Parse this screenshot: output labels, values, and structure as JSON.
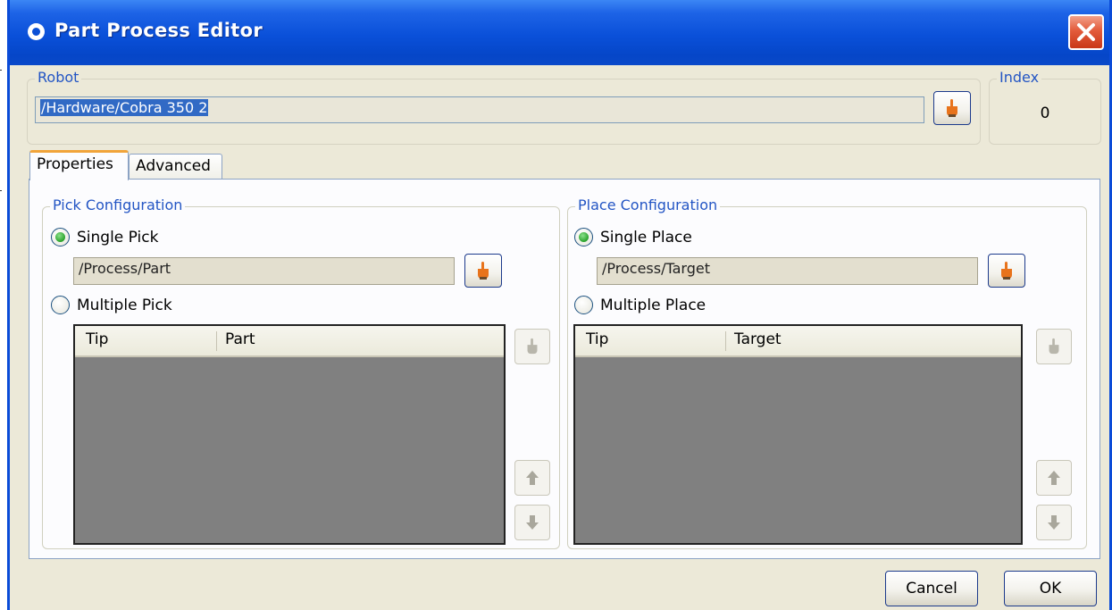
{
  "window": {
    "title": "Part Process Editor"
  },
  "robot": {
    "label": "Robot",
    "value": "/Hardware/Cobra 350 2"
  },
  "index": {
    "label": "Index",
    "value": "0"
  },
  "tabs": [
    {
      "label": "Properties",
      "active": true
    },
    {
      "label": "Advanced",
      "active": false
    }
  ],
  "pick": {
    "group_label": "Pick Configuration",
    "single_label": "Single Pick",
    "single_checked": true,
    "single_value": "/Process/Part",
    "multiple_label": "Multiple Pick",
    "columns": [
      "Tip",
      "Part"
    ]
  },
  "place": {
    "group_label": "Place Configuration",
    "single_label": "Single Place",
    "single_checked": true,
    "single_value": "/Process/Target",
    "multiple_label": "Multiple Place",
    "columns": [
      "Tip",
      "Target"
    ]
  },
  "buttons": {
    "cancel": "Cancel",
    "ok": "OK"
  },
  "icons": {
    "app": "app-logo-icon",
    "close": "close-icon",
    "hand": "hand-pointer-icon",
    "up": "arrow-up-icon",
    "down": "arrow-down-icon"
  },
  "colors": {
    "titlebar": "#0a50d9",
    "group_label": "#2355c4",
    "selection": "#316ac5",
    "list_bg": "#808080"
  }
}
